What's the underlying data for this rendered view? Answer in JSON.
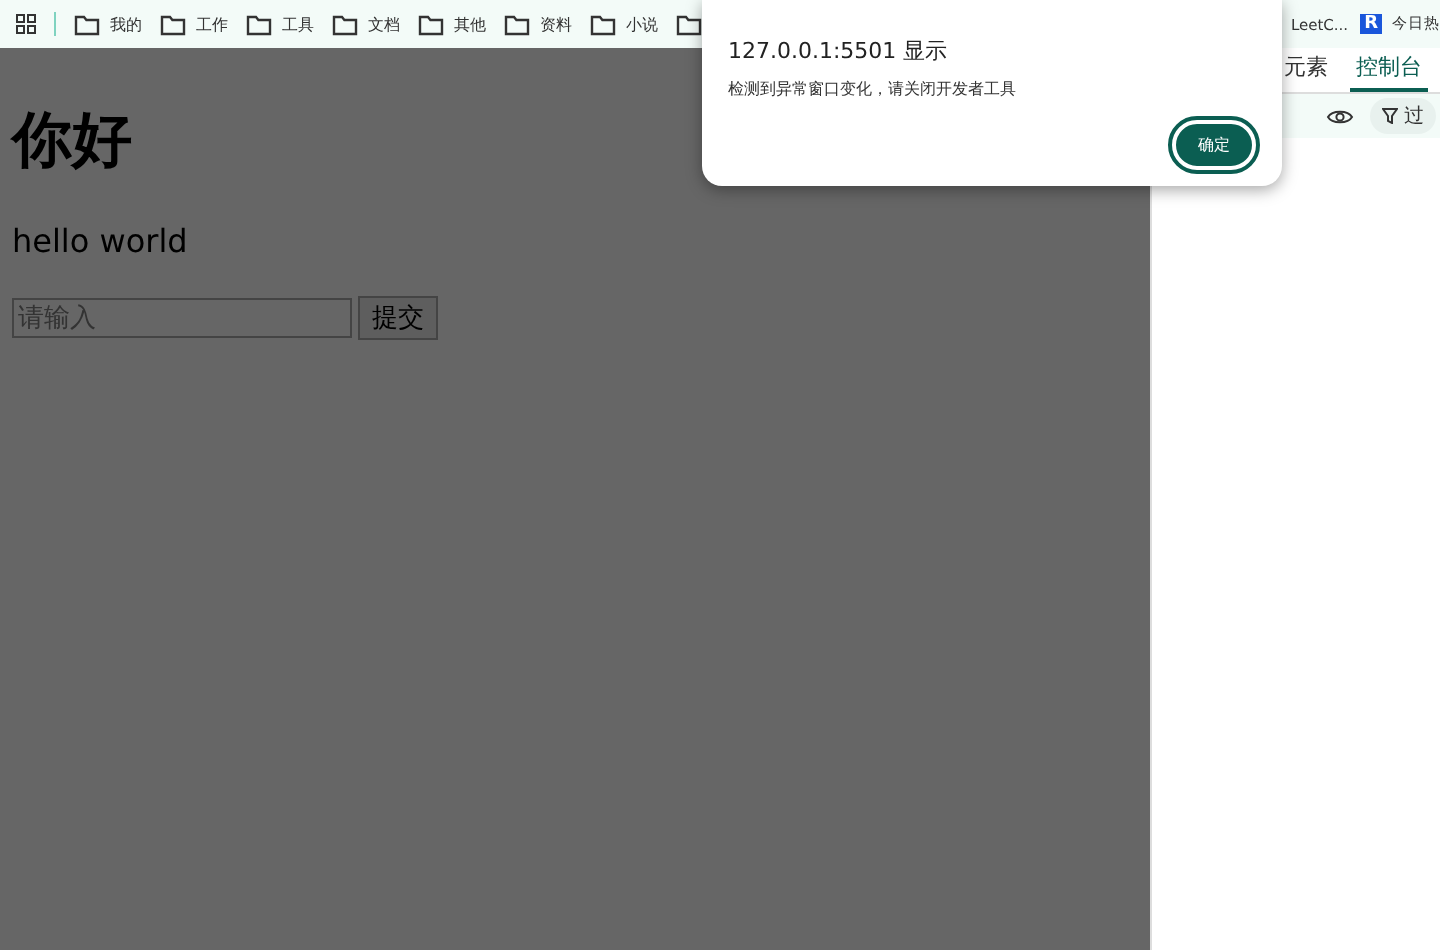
{
  "bookmarks_bar": {
    "folders": [
      {
        "label": "我的"
      },
      {
        "label": "工作"
      },
      {
        "label": "工具"
      },
      {
        "label": "文档"
      },
      {
        "label": "其他"
      },
      {
        "label": "资料"
      },
      {
        "label": "小说"
      }
    ],
    "right_items": [
      {
        "kind": "site",
        "label": "LeetC..."
      },
      {
        "kind": "badge",
        "badge": "R",
        "label": "今日热"
      }
    ]
  },
  "page": {
    "heading": "你好",
    "text": "hello world",
    "input": {
      "placeholder": "请输入"
    },
    "submit_button": "提交"
  },
  "devtools": {
    "tabs": [
      {
        "label": "元素",
        "selected": false
      },
      {
        "label": "控制台",
        "selected": true
      }
    ],
    "filter_button": "过"
  },
  "dialog": {
    "title": "127.0.0.1:5501 显示",
    "message": "检测到异常窗口变化，请关闭开发者工具",
    "ok_button": "确定"
  }
}
